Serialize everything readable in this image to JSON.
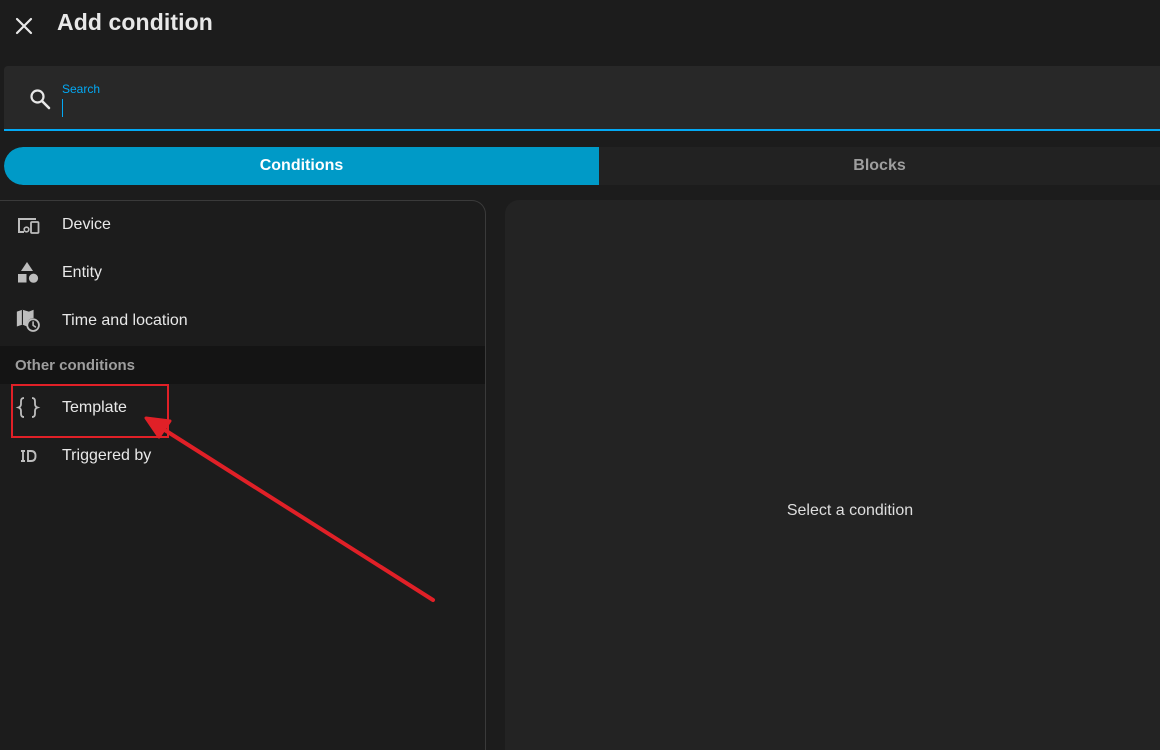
{
  "header": {
    "title": "Add condition",
    "close_icon": "close-icon"
  },
  "search": {
    "label": "Search",
    "value": "",
    "icon": "search-icon"
  },
  "tabs": [
    {
      "label": "Conditions",
      "active": true
    },
    {
      "label": "Blocks",
      "active": false
    }
  ],
  "list": {
    "items": [
      {
        "label": "Device",
        "icon": "device-icon"
      },
      {
        "label": "Entity",
        "icon": "shapes-icon"
      },
      {
        "label": "Time and location",
        "icon": "map-clock-icon"
      }
    ],
    "section_title": "Other conditions",
    "other_items": [
      {
        "label": "Template",
        "icon": "code-braces-icon"
      },
      {
        "label": "Triggered by",
        "icon": "id-icon"
      }
    ]
  },
  "detail": {
    "placeholder": "Select a condition"
  },
  "colors": {
    "accent": "#03a9f4",
    "active_tab": "#009ac7",
    "background": "#1c1c1c",
    "annotation": "#e02027"
  }
}
